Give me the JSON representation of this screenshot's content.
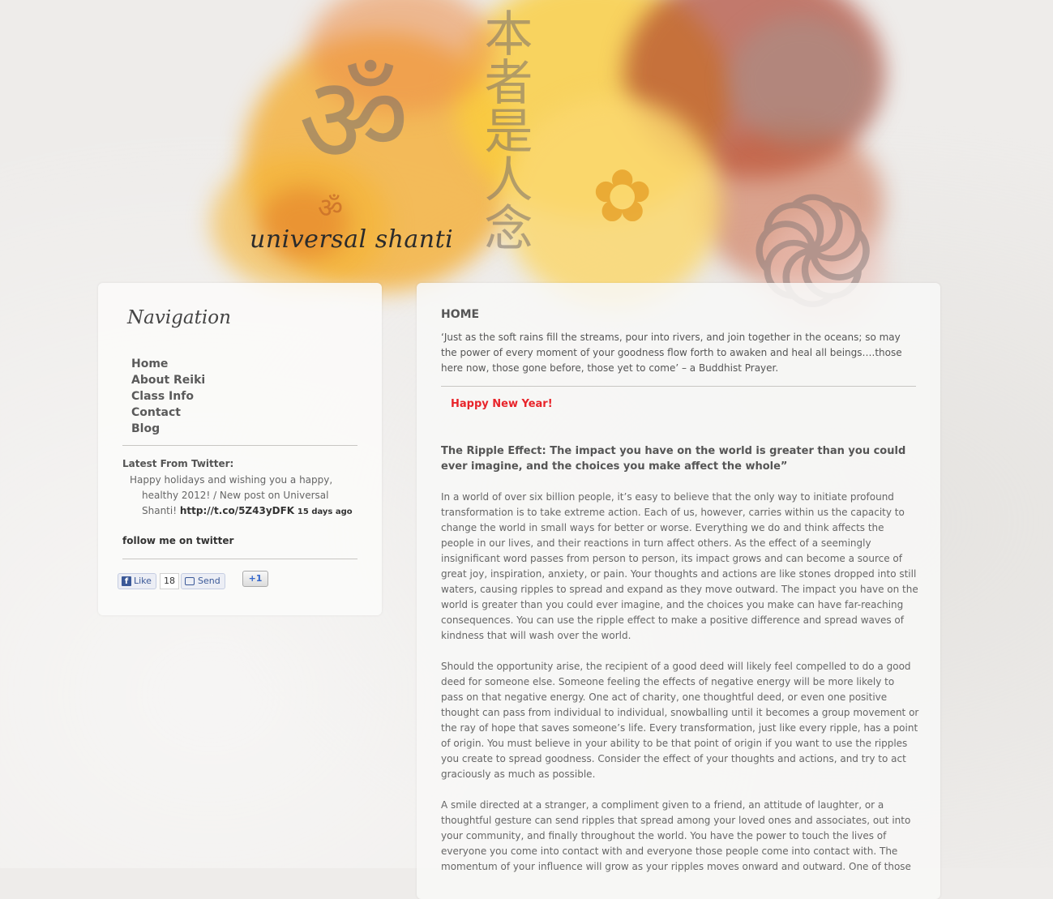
{
  "site": {
    "title": "universal shanti"
  },
  "sidebar": {
    "nav_title": "Navigation",
    "nav_items": [
      {
        "label": "Home"
      },
      {
        "label": "About Reiki"
      },
      {
        "label": "Class Info"
      },
      {
        "label": "Contact"
      },
      {
        "label": "Blog"
      }
    ],
    "twitter": {
      "label": "Latest From Twitter:",
      "tweet_text": "Happy holidays and wishing you a happy, healthy 2012! / New post on Universal Shanti! ",
      "tweet_link": "http://t.co/5Z43yDFK",
      "tweet_age": "15 days ago",
      "follow_label": "follow me on twitter"
    },
    "social": {
      "like_label": "Like",
      "like_count": "18",
      "send_label": "Send",
      "gplus_label": "+1"
    }
  },
  "main": {
    "page_title": "HOME",
    "quote": "‘Just as the soft rains fill the streams, pour into rivers, and join together in the oceans; so may the power of every moment of your goodness flow forth to awaken and heal all beings….those here now, those gone before, those yet to come’ – a Buddhist Prayer.",
    "greeting": "Happy New Year!",
    "post_title": "The Ripple Effect: The impact you have on the world is greater than you could ever imagine, and the choices you make affect the whole”",
    "paragraphs": [
      "In a world of over six billion people, it’s easy to believe that the only way to initiate profound transformation is to take extreme action. Each of us, however, carries within us the capacity to change the world in small ways for better or worse. Everything we do and think affects the people in our lives, and their reactions in turn affect others. As the effect of a seemingly insignificant word passes from person to person, its impact grows and can become a source of great joy, inspiration, anxiety, or pain. Your thoughts and actions are like stones dropped into still waters, causing ripples to spread and expand as they move outward. The impact you have on the world is greater than you could ever imagine, and the choices you make can have far-reaching consequences. You can use the ripple effect to make a positive difference and spread waves of kindness that will wash over the world.",
      "Should the opportunity arise, the recipient of a good deed will likely feel compelled to do a good deed for someone else. Someone feeling the effects of negative energy will be more likely to pass on that negative energy. One act of charity, one thoughtful deed, or even one positive thought can pass from individual to individual, snowballing until it becomes a group movement or the ray of hope that saves someone’s life. Every transformation, just like every ripple, has a point of origin. You must believe in your ability to be that point of origin if you want to use the ripples you create to spread goodness. Consider the effect of your thoughts and actions, and try to act graciously as much as possible.",
      "A smile directed at a stranger, a compliment given to a friend, an attitude of laughter, or a thoughtful gesture can send ripples that spread among your loved ones and associates, out into your community, and finally throughout the world. You have the power to touch the lives of everyone you come into contact with and everyone those people come into contact with. The momentum of your influence will grow as your ripples moves onward and outward. One of those"
    ]
  }
}
